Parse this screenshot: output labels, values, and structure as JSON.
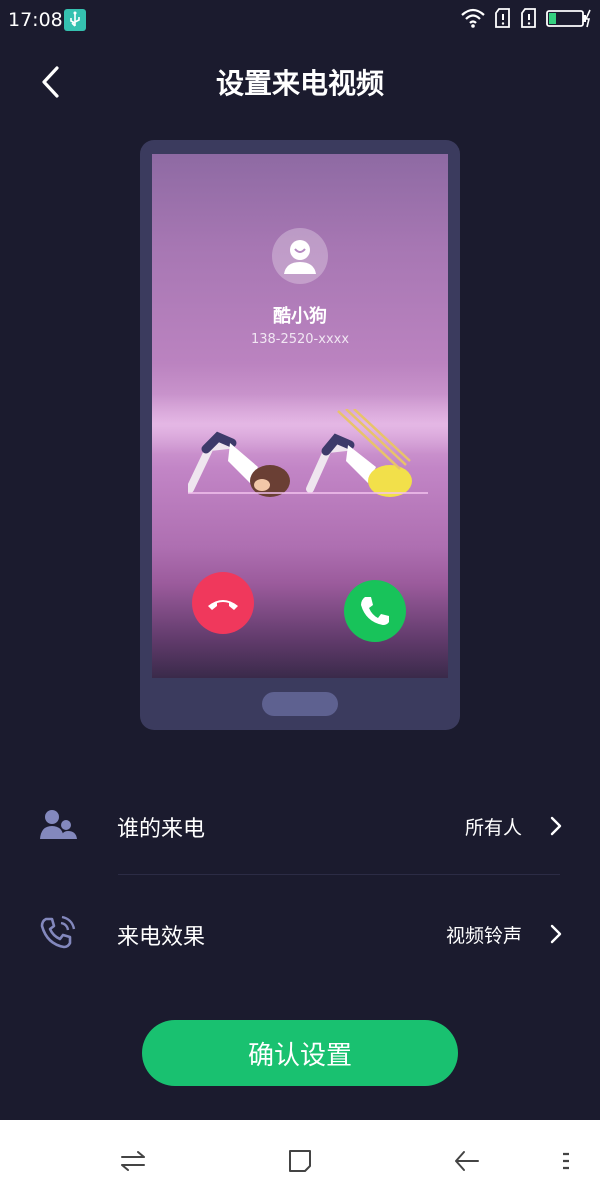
{
  "status_bar": {
    "time": "17:08",
    "icons": [
      "usb-debug-icon",
      "wifi-icon",
      "sim1-no-signal-icon",
      "sim2-no-signal-icon",
      "battery-charging-icon"
    ],
    "colors": {
      "usb_badge": "#35c1b0",
      "battery_fill": "#35d07f"
    }
  },
  "header": {
    "title": "设置来电视频",
    "back_icon": "back-arrow-icon"
  },
  "preview": {
    "contact_name": "酷小狗",
    "contact_number": "138-2520-xxxx",
    "avatar_icon": "person-avatar-icon",
    "decline_icon": "hang-up-icon",
    "accept_icon": "phone-icon",
    "colors": {
      "decline": "#f0385c",
      "accept": "#18c35a",
      "frame": "#3b3b5e"
    }
  },
  "settings": [
    {
      "label": "谁的来电",
      "value": "所有人",
      "icon": "contacts-icon"
    },
    {
      "label": "来电效果",
      "value": "视频铃声",
      "icon": "ringing-phone-icon"
    }
  ],
  "confirm_button": {
    "label": "确认设置",
    "color": "#19c170"
  },
  "nav_bar": {
    "items": [
      "switch-icon",
      "home-square-icon",
      "back-icon",
      "menu-icon"
    ]
  }
}
